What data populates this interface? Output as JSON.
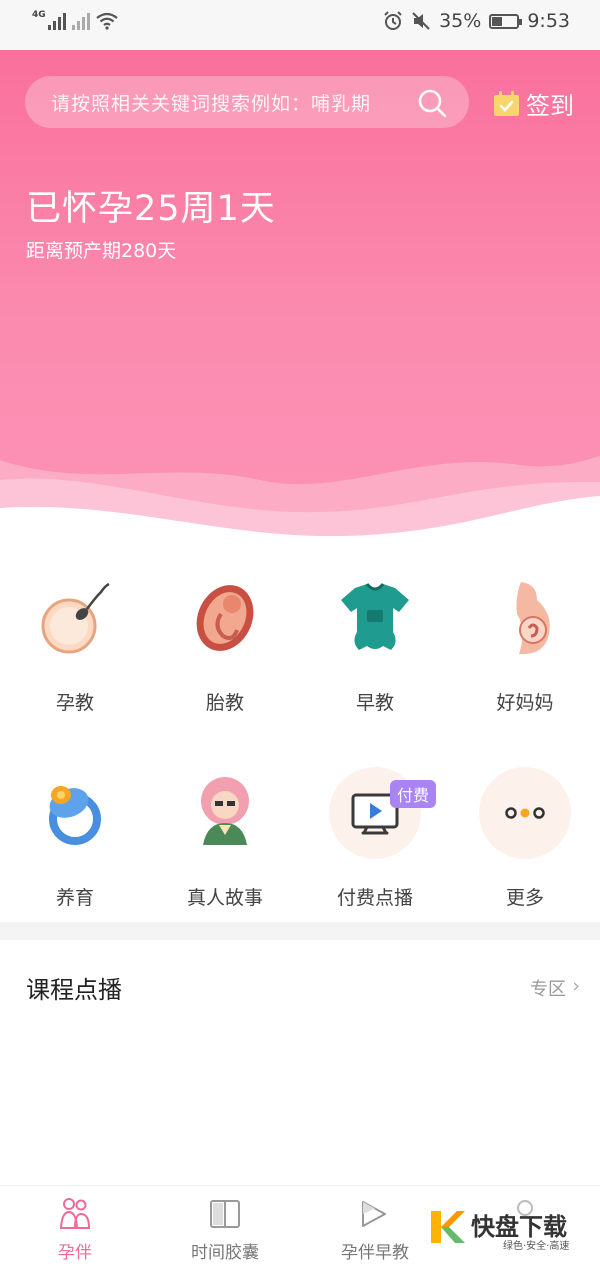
{
  "status_bar": {
    "network": "4G",
    "battery": "35%",
    "time": "9:53"
  },
  "header": {
    "search_placeholder": "请按照相关关键词搜索例如：哺乳期",
    "signin_label": "签到",
    "pregnancy_status": "已怀孕25周1天",
    "due_countdown": "距离预产期280天"
  },
  "grid": {
    "items": [
      {
        "label": "孕教",
        "icon": "sperm-egg-icon"
      },
      {
        "label": "胎教",
        "icon": "fetus-icon"
      },
      {
        "label": "早教",
        "icon": "baby-onesie-icon"
      },
      {
        "label": "好妈妈",
        "icon": "pregnant-belly-icon"
      },
      {
        "label": "养育",
        "icon": "pacifier-icon"
      },
      {
        "label": "真人故事",
        "icon": "person-story-icon"
      },
      {
        "label": "付费点播",
        "icon": "tv-play-icon",
        "badge": "付费"
      },
      {
        "label": "更多",
        "icon": "more-dots-icon"
      }
    ]
  },
  "course_section": {
    "title": "课程点播",
    "more_label": "专区"
  },
  "tab_bar": {
    "tabs": [
      {
        "label": "孕伴",
        "active": true
      },
      {
        "label": "时间胶囊",
        "active": false
      },
      {
        "label": "孕伴早教",
        "active": false
      },
      {
        "label": "",
        "active": false
      }
    ]
  },
  "watermark": {
    "brand": "快盘下载",
    "tagline": "绿色·安全·高速"
  },
  "colors": {
    "header_pink": "#f9709b",
    "active_tab": "#f06a98",
    "badge_purple": "#a984f2"
  }
}
